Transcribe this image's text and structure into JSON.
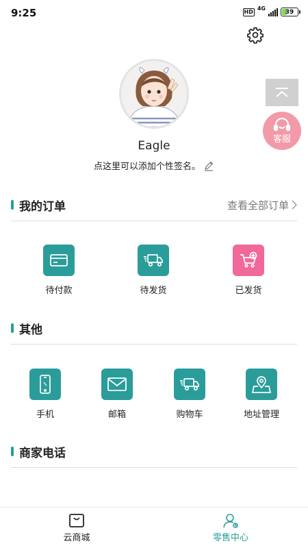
{
  "status": {
    "time": "9:25",
    "hd": "HD",
    "network": "4G",
    "battery": "39",
    "battery_level": 0.39
  },
  "profile": {
    "username": "Eagle",
    "signature": "点这里可以添加个性签名。"
  },
  "float": {
    "kefu_label": "客服"
  },
  "orders": {
    "title": "我的订单",
    "view_all": "查看全部订单",
    "items": [
      {
        "label": "待付款",
        "icon": "card-icon"
      },
      {
        "label": "待发货",
        "icon": "truck-icon"
      },
      {
        "label": "已发货",
        "icon": "cart-plus-icon"
      }
    ]
  },
  "others": {
    "title": "其他",
    "items": [
      {
        "label": "手机",
        "icon": "phone-icon"
      },
      {
        "label": "邮箱",
        "icon": "mail-icon"
      },
      {
        "label": "购物车",
        "icon": "truck-icon"
      },
      {
        "label": "地址管理",
        "icon": "map-pin-icon"
      }
    ]
  },
  "merchant": {
    "title": "商家电话"
  },
  "tabbar": {
    "items": [
      {
        "label": "云商城",
        "icon": "shopping-bag-icon",
        "active": false
      },
      {
        "label": "零售中心",
        "icon": "user-icon",
        "active": true
      }
    ]
  },
  "colors": {
    "accent": "#2a9d9a",
    "pink": "#f2689a",
    "kefu": "#f39aa8",
    "text": "#222222",
    "muted": "#777777"
  }
}
